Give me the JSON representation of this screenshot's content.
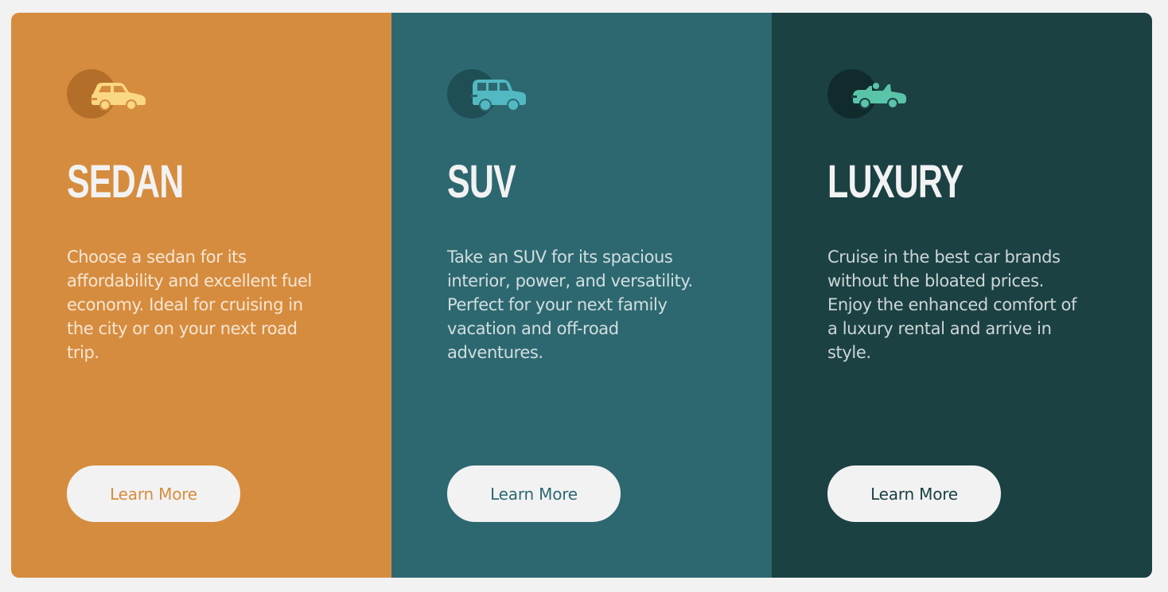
{
  "colors": {
    "page_background": "#f2f2f2",
    "sedan": "#d68c3e",
    "suv": "#2d6870",
    "luxury": "#1b4143",
    "text_light": "#f2f2f2"
  },
  "cards": [
    {
      "id": "sedan",
      "icon": "sedan-car-icon",
      "title": "SEDAN",
      "description": "Choose a sedan for its affordability and excellent fuel economy. Ideal for cruising in the city or on your next road trip.",
      "button_label": "Learn More"
    },
    {
      "id": "suv",
      "icon": "suv-car-icon",
      "title": "SUV",
      "description": "Take an SUV for its spacious interior, power, and versatility. Perfect for your next family vacation and off-road adventures.",
      "button_label": "Learn More"
    },
    {
      "id": "luxury",
      "icon": "luxury-car-icon",
      "title": "LUXURY",
      "description": "Cruise in the best car brands without the bloated prices. Enjoy the enhanced comfort of a luxury rental and arrive in style.",
      "button_label": "Learn More"
    }
  ]
}
